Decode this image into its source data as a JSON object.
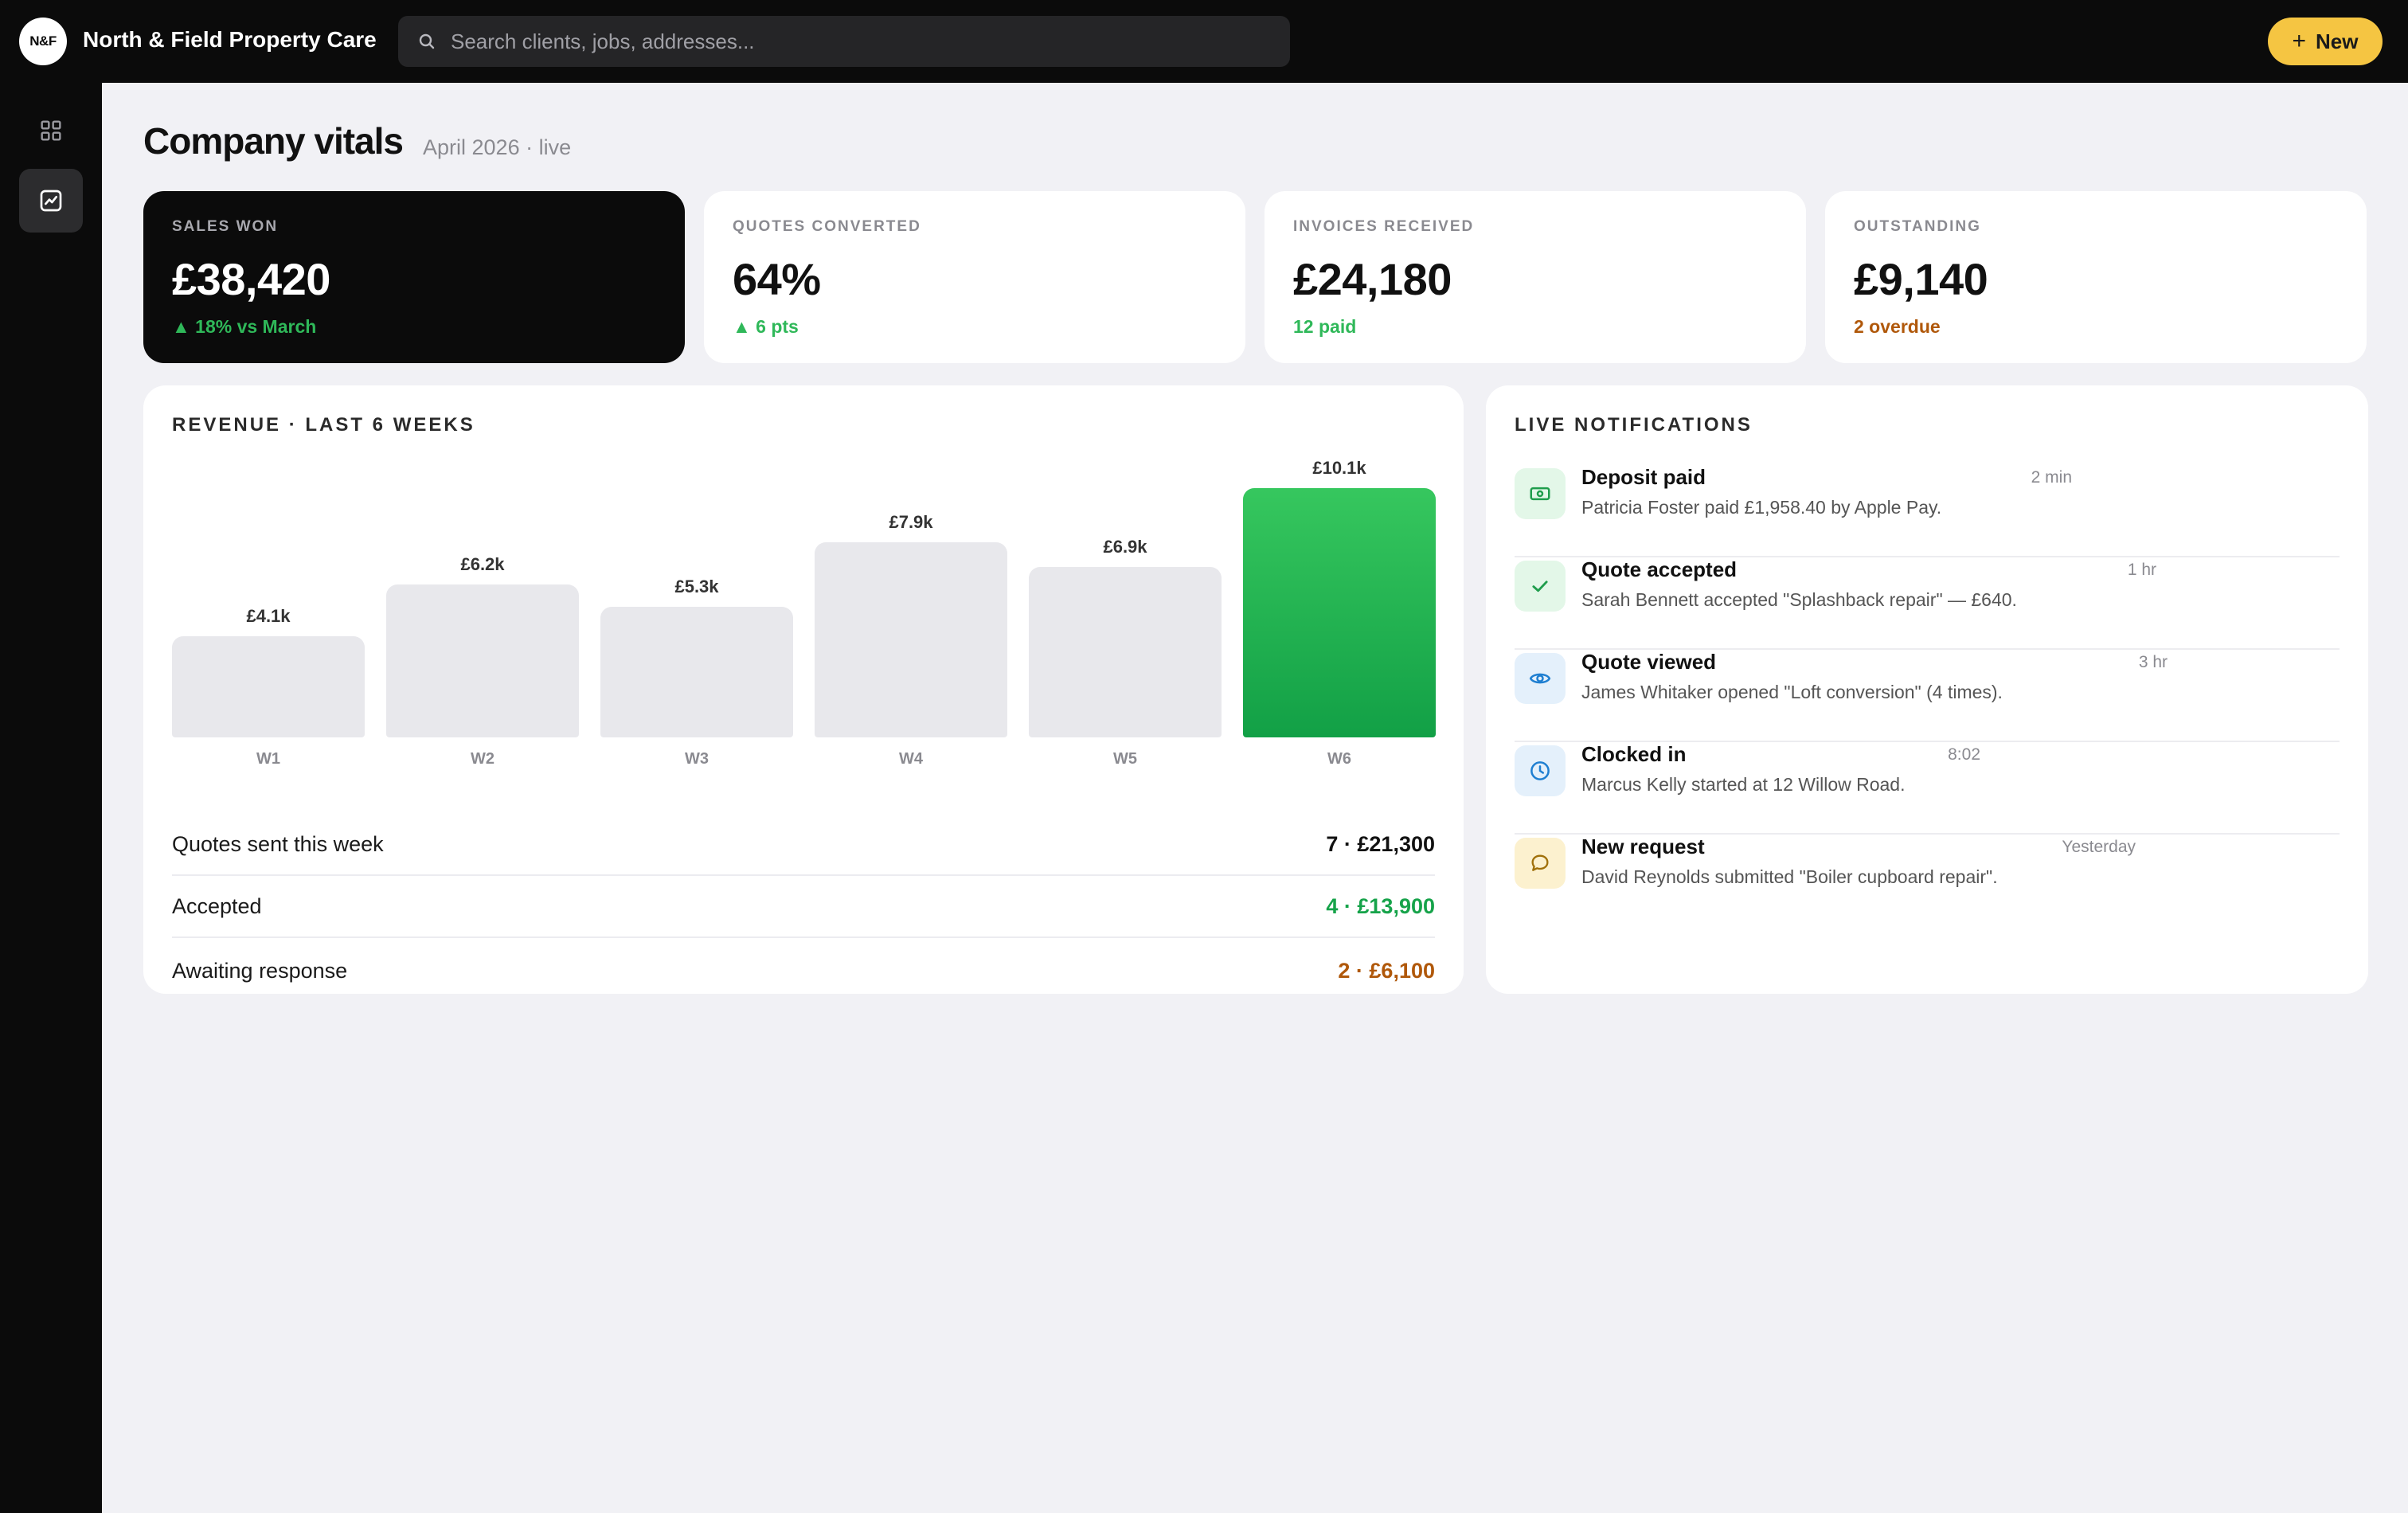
{
  "app": {
    "logo_text": "N&F",
    "company_name": "North & Field Property Care"
  },
  "search": {
    "placeholder": "Search clients, jobs, addresses...",
    "icon": "search-icon"
  },
  "new_button": {
    "label": "New",
    "icon": "plus-icon"
  },
  "sidebar": {
    "items": [
      {
        "name": "dashboard",
        "icon": "grid-icon",
        "active": false
      },
      {
        "name": "analytics",
        "icon": "chart-line-icon",
        "active": true
      }
    ]
  },
  "header": {
    "title": "Company vitals",
    "subtitle": "April 2026 · live"
  },
  "kpis": [
    {
      "label": "SALES WON",
      "value": "£38,420",
      "delta": "▲ 18% vs March",
      "delta_color": "#2fb859",
      "dark": true
    },
    {
      "label": "QUOTES CONVERTED",
      "value": "64%",
      "delta": "▲ 6 pts",
      "delta_color": "#2fb859",
      "dark": false
    },
    {
      "label": "INVOICES RECEIVED",
      "value": "£24,180",
      "delta": "12 paid",
      "delta_color": "#2fb859",
      "dark": false
    },
    {
      "label": "OUTSTANDING",
      "value": "£9,140",
      "delta": "2 overdue",
      "delta_color": "#b0580a",
      "dark": false
    }
  ],
  "revenue": {
    "title": "REVENUE · LAST 6 WEEKS",
    "summary": [
      {
        "label": "Quotes sent this week",
        "value": "7 · £21,300",
        "color": "#111111"
      },
      {
        "label": "Accepted",
        "value": "4 · £13,900",
        "color": "#16a34a"
      },
      {
        "label": "Awaiting response",
        "value": "2 · £6,100",
        "color": "#b0580a"
      }
    ]
  },
  "chart_data": {
    "type": "bar",
    "categories": [
      "W1",
      "W2",
      "W3",
      "W4",
      "W5",
      "W6"
    ],
    "values": [
      4.1,
      6.2,
      5.3,
      7.9,
      6.9,
      10.1
    ],
    "data_labels": [
      "£4.1k",
      "£6.2k",
      "£5.3k",
      "£7.9k",
      "£6.9k",
      "£10.1k"
    ],
    "unit": "£k",
    "highlight_index": 5,
    "highlight_color": "#22b552",
    "bar_color": "#e8e8ec",
    "title": "REVENUE · LAST 6 WEEKS",
    "xlabel": "",
    "ylabel": "",
    "grid": false
  },
  "notifications": {
    "title": "LIVE NOTIFICATIONS",
    "items": [
      {
        "title": "Deposit paid",
        "time": "2 min",
        "desc": "Patricia Foster paid £1,958.40 by Apple Pay.",
        "icon": "cash-icon",
        "icon_bg": "#e3f7e8",
        "icon_color": "#1f9d4c"
      },
      {
        "title": "Quote accepted",
        "time": "1 hr",
        "desc": "Sarah Bennett accepted \"Splashback repair\" — £640.",
        "icon": "check-icon",
        "icon_bg": "#e3f7e8",
        "icon_color": "#1f9d4c"
      },
      {
        "title": "Quote viewed",
        "time": "3 hr",
        "desc": "James Whitaker opened \"Loft conversion\" (4 times).",
        "icon": "eye-icon",
        "icon_bg": "#e4f0fb",
        "icon_color": "#1f7fd1"
      },
      {
        "title": "Clocked in",
        "time": "8:02",
        "desc": "Marcus Kelly started at 12 Willow Road.",
        "icon": "clock-icon",
        "icon_bg": "#e4f0fb",
        "icon_color": "#1f7fd1"
      },
      {
        "title": "New request",
        "time": "Yesterday",
        "desc": "David Reynolds submitted \"Boiler cupboard repair\".",
        "icon": "chat-bubble-icon",
        "icon_bg": "#fcf1cf",
        "icon_color": "#a0700a"
      }
    ]
  }
}
